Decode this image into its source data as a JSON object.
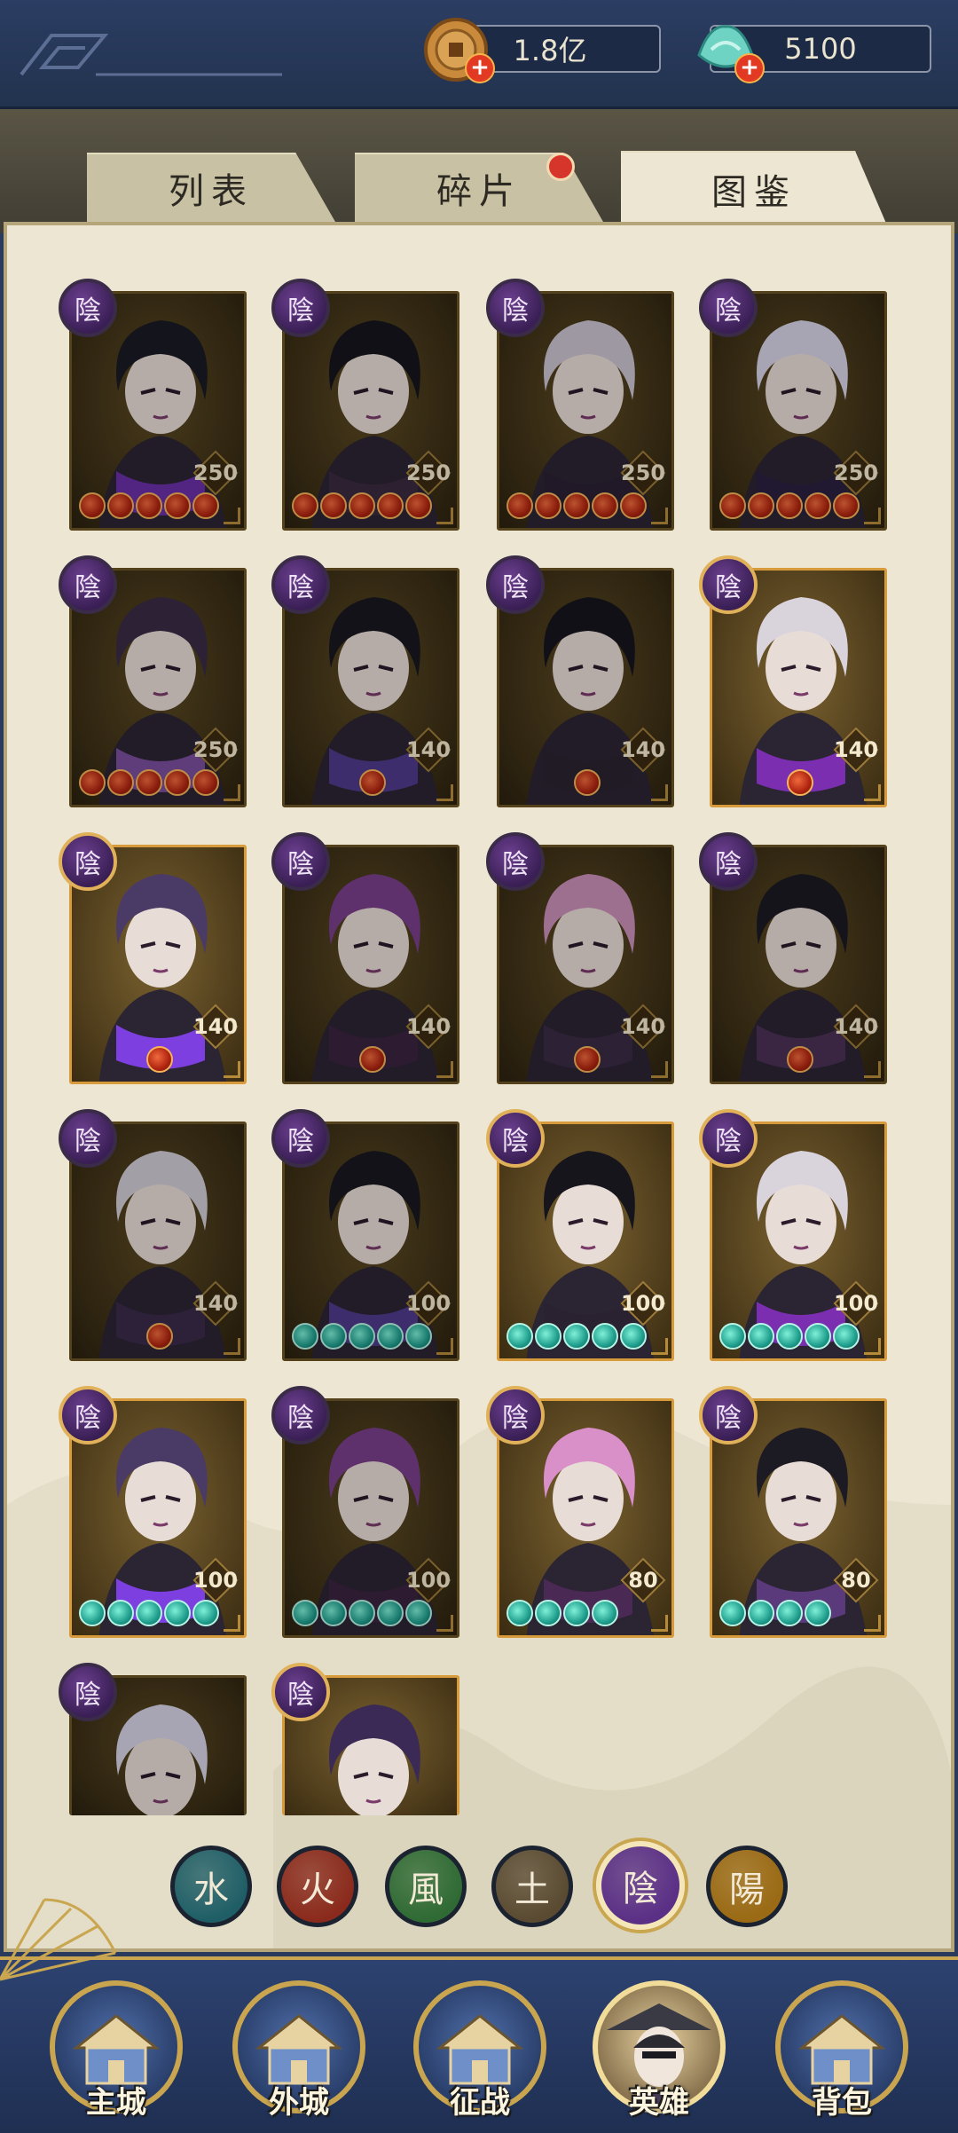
{
  "currency": {
    "coins": {
      "value": "1.8亿",
      "icon": "copper-coin-icon"
    },
    "jade": {
      "value": "5100",
      "icon": "jade-ingot-icon"
    }
  },
  "tabs": [
    {
      "label": "列表",
      "active": false,
      "badge": false
    },
    {
      "label": "碎片",
      "active": false,
      "badge": true
    },
    {
      "label": "图鉴",
      "active": true,
      "badge": false
    }
  ],
  "hero_element_label": "陰",
  "heroes": [
    {
      "level": "250",
      "stars": 5,
      "star_type": "red",
      "frame": "dark",
      "hair": "#1a1a24",
      "scarf": "#6a2fa8"
    },
    {
      "level": "250",
      "stars": 5,
      "star_type": "red",
      "frame": "dark",
      "hair": "#15141c",
      "scarf": "#3a2a3f"
    },
    {
      "level": "250",
      "stars": 5,
      "star_type": "red",
      "frame": "dark",
      "hair": "#c9c3cf",
      "scarf": "#2a1f33"
    },
    {
      "level": "250",
      "stars": 5,
      "star_type": "red",
      "frame": "dark",
      "hair": "#d6d3e6",
      "scarf": "#2a2040"
    },
    {
      "level": "250",
      "stars": 5,
      "star_type": "red",
      "frame": "dark",
      "hair": "#3a2a44",
      "scarf": "#7a4e9e"
    },
    {
      "level": "140",
      "stars": 1,
      "star_type": "red",
      "frame": "dark",
      "hair": "#18171f",
      "scarf": "#4f3a8a"
    },
    {
      "level": "140",
      "stars": 1,
      "star_type": "red",
      "frame": "dark",
      "hair": "#16151c",
      "scarf": "#2a2230"
    },
    {
      "level": "140",
      "stars": 1,
      "star_type": "red",
      "frame": "gold",
      "hair": "#d9d4dc",
      "scarf": "#7b2fb0"
    },
    {
      "level": "140",
      "stars": 1,
      "star_type": "red",
      "frame": "gold",
      "hair": "#4a3a66",
      "scarf": "#7d3fe0"
    },
    {
      "level": "140",
      "stars": 1,
      "star_type": "red",
      "frame": "dark",
      "hair": "#7a3f8a",
      "scarf": "#3a2240"
    },
    {
      "level": "140",
      "stars": 1,
      "star_type": "red",
      "frame": "dark",
      "hair": "#c98fb8",
      "scarf": "#3a2a44"
    },
    {
      "level": "140",
      "stars": 1,
      "star_type": "red",
      "frame": "dark",
      "hair": "#1c1a22",
      "scarf": "#4a2f55"
    },
    {
      "level": "140",
      "stars": 1,
      "star_type": "red",
      "frame": "dark",
      "hair": "#d0ccd6",
      "scarf": "#3a2a4a"
    },
    {
      "level": "100",
      "stars": 5,
      "star_type": "green",
      "frame": "dark",
      "hair": "#18171f",
      "scarf": "#4f3a8a"
    },
    {
      "level": "100",
      "stars": 5,
      "star_type": "green",
      "frame": "gold",
      "hair": "#16151c",
      "scarf": "#2a2230"
    },
    {
      "level": "100",
      "stars": 5,
      "star_type": "green",
      "frame": "gold",
      "hair": "#d9d4dc",
      "scarf": "#7b2fb0"
    },
    {
      "level": "100",
      "stars": 5,
      "star_type": "green",
      "frame": "gold",
      "hair": "#4a3a66",
      "scarf": "#7d3fe0"
    },
    {
      "level": "100",
      "stars": 5,
      "star_type": "green",
      "frame": "dark",
      "hair": "#7a3f8a",
      "scarf": "#3a2240"
    },
    {
      "level": "80",
      "stars": 4,
      "star_type": "green",
      "frame": "gold",
      "hair": "#d98fc8",
      "scarf": "#4a2a55"
    },
    {
      "level": "80",
      "stars": 4,
      "star_type": "green",
      "frame": "gold",
      "hair": "#1c1a22",
      "scarf": "#5a3a7a"
    },
    {
      "level": "",
      "stars": 0,
      "star_type": "none",
      "frame": "dark",
      "hair": "#d6d3e6",
      "scarf": "#2a1f40"
    },
    {
      "level": "",
      "stars": 0,
      "star_type": "none",
      "frame": "gold",
      "hair": "#3a2a55",
      "scarf": "#2a2040"
    }
  ],
  "element_filters": [
    {
      "label": "水",
      "color": "#1f5e66",
      "active": false,
      "icon": "water-element-icon"
    },
    {
      "label": "火",
      "color": "#8a2a1c",
      "active": false,
      "icon": "fire-element-icon"
    },
    {
      "label": "風",
      "color": "#2f6a34",
      "active": false,
      "icon": "wind-element-icon"
    },
    {
      "label": "土",
      "color": "#5a4a32",
      "active": false,
      "icon": "earth-element-icon"
    },
    {
      "label": "陰",
      "color": "#5a2f86",
      "active": true,
      "icon": "yin-element-icon"
    },
    {
      "label": "陽",
      "color": "#9a6a14",
      "active": false,
      "icon": "yang-element-icon"
    }
  ],
  "bottom_nav": [
    {
      "label": "主城",
      "icon": "main-city-icon"
    },
    {
      "label": "外城",
      "icon": "outer-city-icon"
    },
    {
      "label": "征战",
      "icon": "campaign-icon"
    },
    {
      "label": "英雄",
      "icon": "hero-icon",
      "active": true
    },
    {
      "label": "背包",
      "icon": "backpack-icon"
    }
  ]
}
